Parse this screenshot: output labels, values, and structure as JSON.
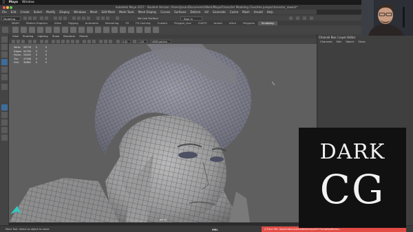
{
  "macbar": {
    "apple": "",
    "app": "Maya",
    "menu": "Window"
  },
  "window": {
    "title": "Autodesk Maya 2017 - Student Version: /Users/jason/Documents/Work/Maya/Character Modeling Class/the.jumps/character_rework*"
  },
  "maya_menu": [
    "File",
    "Edit",
    "Create",
    "Select",
    "Modify",
    "Display",
    "Windows",
    "Mesh",
    "Edit Mesh",
    "Mesh Tools",
    "Mesh Display",
    "Curves",
    "Surfaces",
    "Deform",
    "UV",
    "Generate",
    "Cache",
    "Mash",
    "Arnold",
    "Help"
  ],
  "status": {
    "mode": "Modeling",
    "live_surface": "No Live Surface",
    "sign_in": "Sign In"
  },
  "shelf_tabs": [
    {
      "label": "MASH",
      "active": false
    },
    {
      "label": "Motion Graphics",
      "active": false
    },
    {
      "label": "XGen",
      "active": false
    },
    {
      "label": "Rigging",
      "active": false
    },
    {
      "label": "Animation",
      "active": false
    },
    {
      "label": "Rendering",
      "active": false
    },
    {
      "label": "FX",
      "active": false
    },
    {
      "label": "FX Caching",
      "active": false
    },
    {
      "label": "Custom",
      "active": false
    },
    {
      "label": "Polygon_Live",
      "active": false
    },
    {
      "label": "CUSTZ",
      "active": false
    },
    {
      "label": "Arnold",
      "active": false
    },
    {
      "label": "XGen",
      "active": false
    },
    {
      "label": "Polygons",
      "active": false
    },
    {
      "label": "Sculpting",
      "active": true
    }
  ],
  "viewport_menu": [
    "View",
    "Shading",
    "Lighting",
    "Show",
    "Renderer",
    "Panels"
  ],
  "viewport_toolbar": {
    "field_1": "0.00",
    "field_2": "1.00",
    "colorspace": "sRGB gamma"
  },
  "hud": [
    {
      "label": "Verts:",
      "v1": "26776",
      "v2": "0"
    },
    {
      "label": "Edges:",
      "v1": "50795",
      "v2": "0"
    },
    {
      "label": "Faces:",
      "v1": "24402",
      "v2": "0"
    },
    {
      "label": "Tris:",
      "v1": "47596",
      "v2": "0"
    },
    {
      "label": "UVs:",
      "v1": "30861",
      "v2": "0"
    }
  ],
  "camera_label": "persp",
  "channel_box": {
    "title": "Channel Box / Layer Editor",
    "menu": [
      "Channels",
      "Edit",
      "Object",
      "Show"
    ]
  },
  "help_line": "Move Tool: Select an object to move.",
  "mel": "MEL",
  "error_line": "// Error: file: /Applications/Autodesk/maya2017/scripts/others/...",
  "watermark": {
    "line1": "DARK",
    "line2": "CG"
  },
  "colors": {
    "error": "#e24c45",
    "active_tab": "#5a5a5a",
    "mesh_wire": "#1e2a8a"
  }
}
